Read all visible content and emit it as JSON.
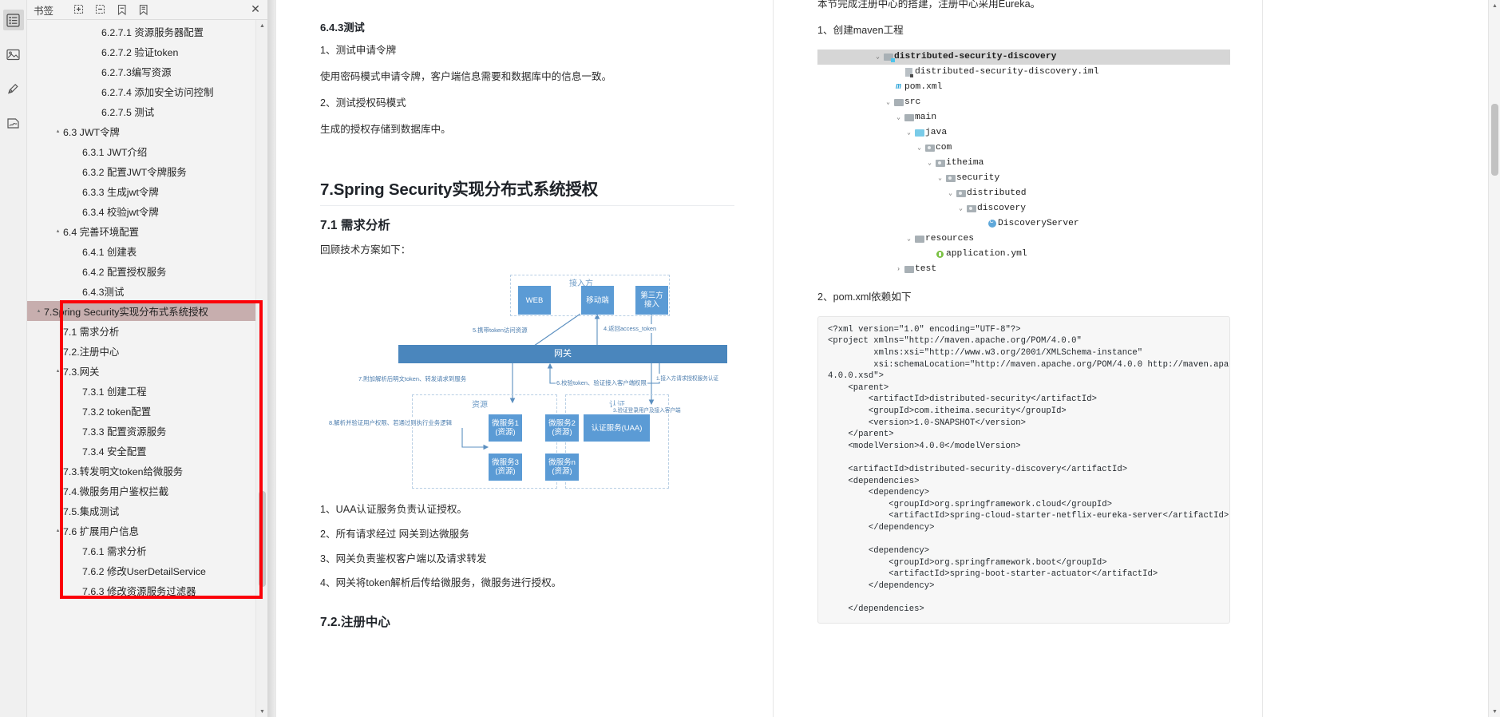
{
  "bookmarks_panel": {
    "title": "书签",
    "tools": [
      {
        "name": "add-bookmark-icon",
        "label": "添加书签"
      },
      {
        "name": "remove-bookmark-icon",
        "label": "删除书签"
      },
      {
        "name": "expand-bookmarks-icon",
        "label": "展开书签"
      },
      {
        "name": "collapse-bookmarks-icon",
        "label": "折叠书签"
      }
    ],
    "close_label": "✕",
    "items": [
      {
        "label": "6.2.7.1 资源服务器配置",
        "indent": 3,
        "twisty": "",
        "selected": false
      },
      {
        "label": "6.2.7.2 验证token",
        "indent": 3,
        "twisty": "",
        "selected": false
      },
      {
        "label": "6.2.7.3编写资源",
        "indent": 3,
        "twisty": "",
        "selected": false
      },
      {
        "label": "6.2.7.4 添加安全访问控制",
        "indent": 3,
        "twisty": "",
        "selected": false
      },
      {
        "label": "6.2.7.5 测试",
        "indent": 3,
        "twisty": "",
        "selected": false
      },
      {
        "label": "6.3 JWT令牌",
        "indent": 1,
        "twisty": "▴",
        "selected": false
      },
      {
        "label": "6.3.1 JWT介绍",
        "indent": 2,
        "twisty": "",
        "selected": false
      },
      {
        "label": "6.3.2 配置JWT令牌服务",
        "indent": 2,
        "twisty": "",
        "selected": false
      },
      {
        "label": "6.3.3 生成jwt令牌",
        "indent": 2,
        "twisty": "",
        "selected": false
      },
      {
        "label": "6.3.4 校验jwt令牌",
        "indent": 2,
        "twisty": "",
        "selected": false
      },
      {
        "label": "6.4 完善环境配置",
        "indent": 1,
        "twisty": "▴",
        "selected": false
      },
      {
        "label": "6.4.1 创建表",
        "indent": 2,
        "twisty": "",
        "selected": false
      },
      {
        "label": "6.4.2 配置授权服务",
        "indent": 2,
        "twisty": "",
        "selected": false
      },
      {
        "label": "6.4.3测试",
        "indent": 2,
        "twisty": "",
        "selected": false
      },
      {
        "label": "7.Spring Security实现分布式系统授权",
        "indent": 0,
        "twisty": "▴",
        "selected": true
      },
      {
        "label": "7.1 需求分析",
        "indent": 1,
        "twisty": "",
        "selected": false
      },
      {
        "label": "7.2.注册中心",
        "indent": 1,
        "twisty": "",
        "selected": false
      },
      {
        "label": "7.3.网关",
        "indent": 1,
        "twisty": "▴",
        "selected": false
      },
      {
        "label": "7.3.1 创建工程",
        "indent": 2,
        "twisty": "",
        "selected": false
      },
      {
        "label": "7.3.2 token配置",
        "indent": 2,
        "twisty": "",
        "selected": false
      },
      {
        "label": "7.3.3 配置资源服务",
        "indent": 2,
        "twisty": "",
        "selected": false
      },
      {
        "label": "7.3.4 安全配置",
        "indent": 2,
        "twisty": "",
        "selected": false
      },
      {
        "label": "7.3.转发明文token给微服务",
        "indent": 1,
        "twisty": "",
        "selected": false
      },
      {
        "label": "7.4.微服务用户鉴权拦截",
        "indent": 1,
        "twisty": "",
        "selected": false
      },
      {
        "label": "7.5.集成测试",
        "indent": 1,
        "twisty": "",
        "selected": false
      },
      {
        "label": "7.6 扩展用户信息",
        "indent": 1,
        "twisty": "▴",
        "selected": false
      },
      {
        "label": "7.6.1 需求分析",
        "indent": 2,
        "twisty": "",
        "selected": false
      },
      {
        "label": "7.6.2 修改UserDetailService",
        "indent": 2,
        "twisty": "",
        "selected": false
      },
      {
        "label": "7.6.3 修改资源服务过滤器",
        "indent": 2,
        "twisty": "",
        "selected": false
      }
    ]
  },
  "left_page": {
    "h_643": "6.4.3测试",
    "p1": "1、测试申请令牌",
    "p2": "使用密码模式申请令牌，客户端信息需要和数据库中的信息一致。",
    "p3": "2、测试授权码模式",
    "p4": "生成的授权存储到数据库中。",
    "h_7": "7.Spring Security实现分布式系统授权",
    "h_71": "7.1 需求分析",
    "p5": "回顾技术方案如下：",
    "list": [
      "1、UAA认证服务负责认证授权。",
      "2、所有请求经过 网关到达微服务",
      "3、网关负责鉴权客户端以及请求转发",
      "4、网关将token解析后传给微服务，微服务进行授权。"
    ],
    "h_72": "7.2.注册中心"
  },
  "diagram": {
    "groups": [
      {
        "label": "接入方"
      },
      {
        "label": "资源"
      },
      {
        "label": "认证"
      }
    ],
    "boxes": [
      {
        "name": "web",
        "lines": [
          "WEB"
        ]
      },
      {
        "name": "mobile",
        "lines": [
          "移动端"
        ]
      },
      {
        "name": "third-party",
        "lines": [
          "第三方",
          "接入"
        ]
      },
      {
        "name": "gateway",
        "lines": [
          "网关"
        ]
      },
      {
        "name": "ms1",
        "lines": [
          "微服务1",
          "(资源)"
        ]
      },
      {
        "name": "ms2",
        "lines": [
          "微服务2",
          "(资源)"
        ]
      },
      {
        "name": "ms3",
        "lines": [
          "微服务3",
          "(资源)"
        ]
      },
      {
        "name": "msn",
        "lines": [
          "微服务n",
          "(资源)"
        ]
      },
      {
        "name": "uaa",
        "lines": [
          "认证服务(UAA)"
        ]
      }
    ],
    "labels": [
      "5.携带token访问资源",
      "4.返回access_token",
      "7.附加解析后明文token、转发请求到服务",
      "6.校验token、验证接入客户端权限",
      "8.解析并验证用户权限、若通过则执行业务逻辑",
      "1.接入方请求授权服务认证",
      "3.验证登录用户及接入客户端"
    ],
    "colors": {
      "box": "#5b9bd5",
      "gateway": "#4a86bd",
      "line": "#4b7cad",
      "group_border": "#b9cfe4"
    }
  },
  "right_page": {
    "p_top": "本节完成注册中心的搭建，注册中心采用Eureka。",
    "p_step1": "1、创建maven工程",
    "p_step2": "2、pom.xml依赖如下",
    "tree": [
      {
        "chev": "⌄",
        "icon": "folder-badge",
        "name": "distributed-security-discovery",
        "indent": 0,
        "hl": true,
        "bold": true
      },
      {
        "chev": "",
        "icon": "iml",
        "name": "distributed-security-discovery.iml",
        "indent": 2,
        "hl": false,
        "bold": false
      },
      {
        "chev": "",
        "icon": "maven",
        "name": "pom.xml",
        "indent": 1,
        "hl": false,
        "bold": false
      },
      {
        "chev": "⌄",
        "icon": "folder",
        "name": "src",
        "indent": 1,
        "hl": false,
        "bold": false
      },
      {
        "chev": "⌄",
        "icon": "folder",
        "name": "main",
        "indent": 2,
        "hl": false,
        "bold": false
      },
      {
        "chev": "⌄",
        "icon": "folder-blue",
        "name": "java",
        "indent": 3,
        "hl": false,
        "bold": false
      },
      {
        "chev": "⌄",
        "icon": "package",
        "name": "com",
        "indent": 4,
        "hl": false,
        "bold": false
      },
      {
        "chev": "⌄",
        "icon": "package",
        "name": "itheima",
        "indent": 5,
        "hl": false,
        "bold": false
      },
      {
        "chev": "⌄",
        "icon": "package",
        "name": "security",
        "indent": 6,
        "hl": false,
        "bold": false
      },
      {
        "chev": "⌄",
        "icon": "package",
        "name": "distributed",
        "indent": 7,
        "hl": false,
        "bold": false
      },
      {
        "chev": "⌄",
        "icon": "package",
        "name": "discovery",
        "indent": 8,
        "hl": false,
        "bold": false
      },
      {
        "chev": "",
        "icon": "class",
        "name": "DiscoveryServer",
        "indent": 10,
        "hl": false,
        "bold": false
      },
      {
        "chev": "⌄",
        "icon": "folder",
        "name": "resources",
        "indent": 3,
        "hl": false,
        "bold": false
      },
      {
        "chev": "",
        "icon": "yaml",
        "name": "application.yml",
        "indent": 5,
        "hl": false,
        "bold": false
      },
      {
        "chev": "›",
        "icon": "folder",
        "name": "test",
        "indent": 2,
        "hl": false,
        "bold": false
      }
    ],
    "code": "<?xml version=\"1.0\" encoding=\"UTF-8\"?>\n<project xmlns=\"http://maven.apache.org/POM/4.0.0\"\n         xmlns:xsi=\"http://www.w3.org/2001/XMLSchema-instance\"\n         xsi:schemaLocation=\"http://maven.apache.org/POM/4.0.0 http://maven.apache.org/xsd/maven-\n4.0.0.xsd\">\n    <parent>\n        <artifactId>distributed-security</artifactId>\n        <groupId>com.itheima.security</groupId>\n        <version>1.0-SNAPSHOT</version>\n    </parent>\n    <modelVersion>4.0.0</modelVersion>\n\n    <artifactId>distributed-security-discovery</artifactId>\n    <dependencies>\n        <dependency>\n            <groupId>org.springframework.cloud</groupId>\n            <artifactId>spring-cloud-starter-netflix-eureka-server</artifactId>\n        </dependency>\n\n        <dependency>\n            <groupId>org.springframework.boot</groupId>\n            <artifactId>spring-boot-starter-actuator</artifactId>\n        </dependency>\n\n    </dependencies>"
  },
  "scrollbars": {
    "up_arrow": "▲",
    "down_arrow": "▼"
  }
}
